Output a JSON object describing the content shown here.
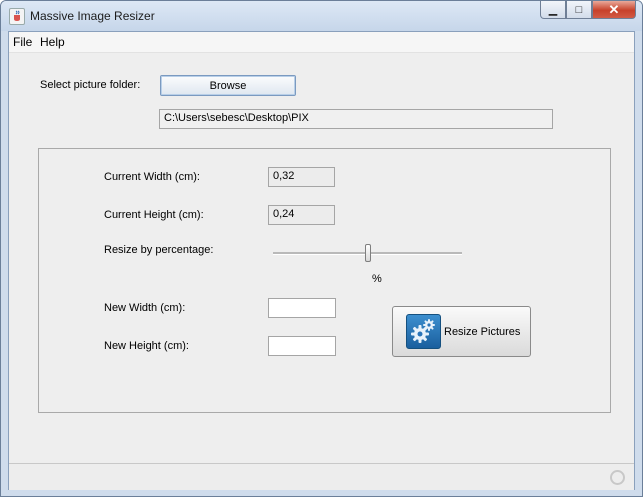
{
  "window": {
    "title": "Massive Image Resizer",
    "icons": {
      "app": "java-cup-icon",
      "minimize": "minimize-icon",
      "maximize": "maximize-icon",
      "close": "close-icon"
    }
  },
  "menu": {
    "file": "File",
    "help": "Help"
  },
  "folder": {
    "label": "Select picture folder:",
    "browse_label": "Browse",
    "path": "C:\\Users\\sebesc\\Desktop\\PIX"
  },
  "panel": {
    "current_width_label": "Current Width (cm):",
    "current_width_value": "0,32",
    "current_height_label": "Current Height (cm):",
    "current_height_value": "0,24",
    "resize_label": "Resize by percentage:",
    "slider_value": 0.5,
    "percent_label": "%",
    "new_width_label": "New Width (cm):",
    "new_width_value": "",
    "new_height_label": "New Height (cm):",
    "new_height_value": "",
    "resize_button_label": "Resize Pictures",
    "resize_icon": "gears-icon"
  },
  "colors": {
    "accent": "#1a5f9e",
    "close": "#c7412a"
  }
}
